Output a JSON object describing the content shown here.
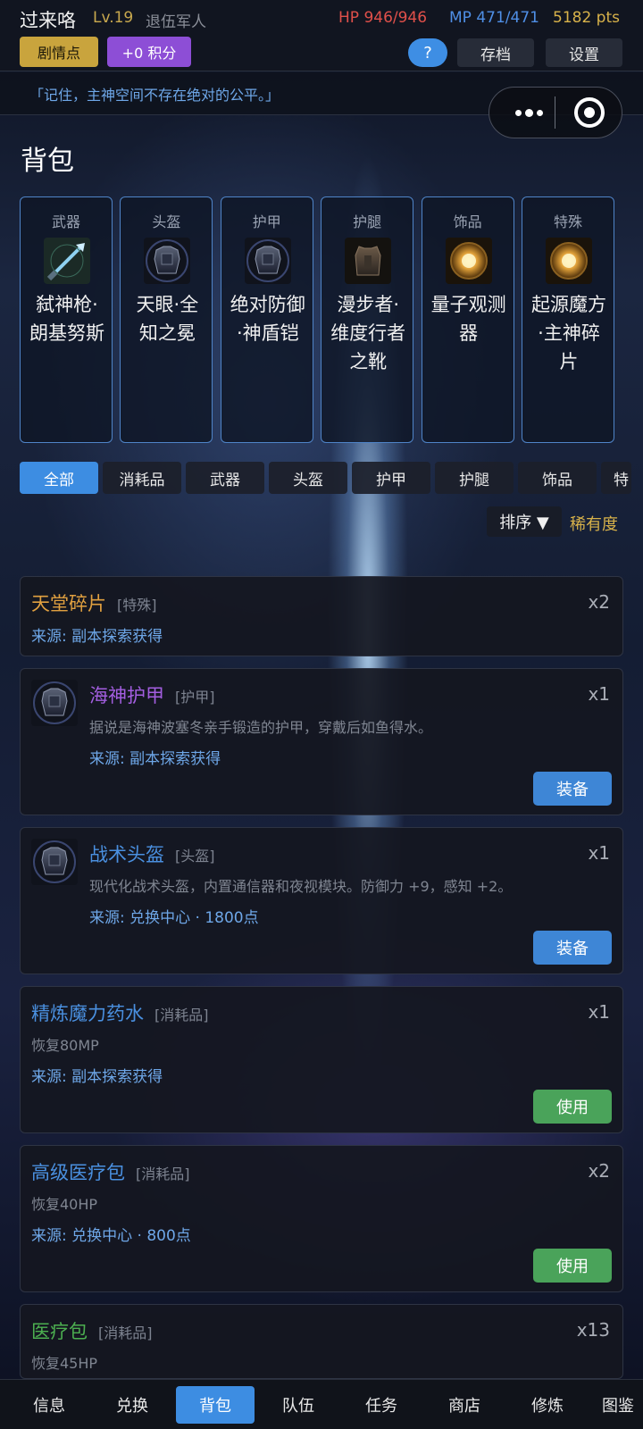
{
  "status": {
    "name": "过来咯",
    "level": "Lv.19",
    "rank": "退伍军人",
    "hp": "HP 946/946",
    "mp": "MP 471/471",
    "points": "5182 pts"
  },
  "actions": {
    "plot": "剧情点",
    "points_bonus": "+0 积分",
    "help": "?",
    "save": "存档",
    "settings": "设置"
  },
  "quote": "「记住，主神空间不存在绝对的公平。」",
  "page_title": "背包",
  "equipment": [
    {
      "slot": "武器",
      "name": "弑神枪·朗基努斯",
      "icon": "spear-icon"
    },
    {
      "slot": "头盔",
      "name": "天眼·全知之冕",
      "icon": "armor-icon"
    },
    {
      "slot": "护甲",
      "name": "绝对防御·神盾铠",
      "icon": "armor-icon"
    },
    {
      "slot": "护腿",
      "name": "漫步者·维度行者之靴",
      "icon": "vest-icon"
    },
    {
      "slot": "饰品",
      "name": "量子观测器",
      "icon": "medallion-icon"
    },
    {
      "slot": "特殊",
      "name": "起源魔方·主神碎片",
      "icon": "medallion-icon"
    }
  ],
  "tabs": [
    "全部",
    "消耗品",
    "武器",
    "头盔",
    "护甲",
    "护腿",
    "饰品",
    "特"
  ],
  "active_tab": "全部",
  "sort": {
    "label": "排序 ▼",
    "mode": "稀有度"
  },
  "items": [
    {
      "name": "天堂碎片",
      "tag": "[特殊]",
      "qty": "x2",
      "desc": "",
      "source": "来源: 副本探索获得",
      "button": "",
      "color": "#e0a040"
    },
    {
      "name": "海神护甲",
      "tag": "[护甲]",
      "qty": "x1",
      "desc": "据说是海神波塞冬亲手锻造的护甲，穿戴后如鱼得水。",
      "source": "来源: 副本探索获得",
      "button": "装备",
      "color": "#a35ee0"
    },
    {
      "name": "战术头盔",
      "tag": "[头盔]",
      "qty": "x1",
      "desc": "现代化战术头盔，内置通信器和夜视模块。防御力 +9，感知 +2。",
      "source": "来源: 兑换中心 · 1800点",
      "button": "装备",
      "color": "#4a90e0"
    },
    {
      "name": "精炼魔力药水",
      "tag": "[消耗品]",
      "qty": "x1",
      "desc": "恢复80MP",
      "source": "来源: 副本探索获得",
      "button": "使用",
      "color": "#4a90e0"
    },
    {
      "name": "高级医疗包",
      "tag": "[消耗品]",
      "qty": "x2",
      "desc": "恢复40HP",
      "source": "来源: 兑换中心 · 800点",
      "button": "使用",
      "color": "#4a90e0"
    },
    {
      "name": "医疗包",
      "tag": "[消耗品]",
      "qty": "x13",
      "desc": "恢复45HP",
      "source": "",
      "button": "",
      "color": "#4caf50"
    }
  ],
  "nav": [
    "信息",
    "兑换",
    "背包",
    "队伍",
    "任务",
    "商店",
    "修炼",
    "图鉴"
  ],
  "active_nav": "背包"
}
